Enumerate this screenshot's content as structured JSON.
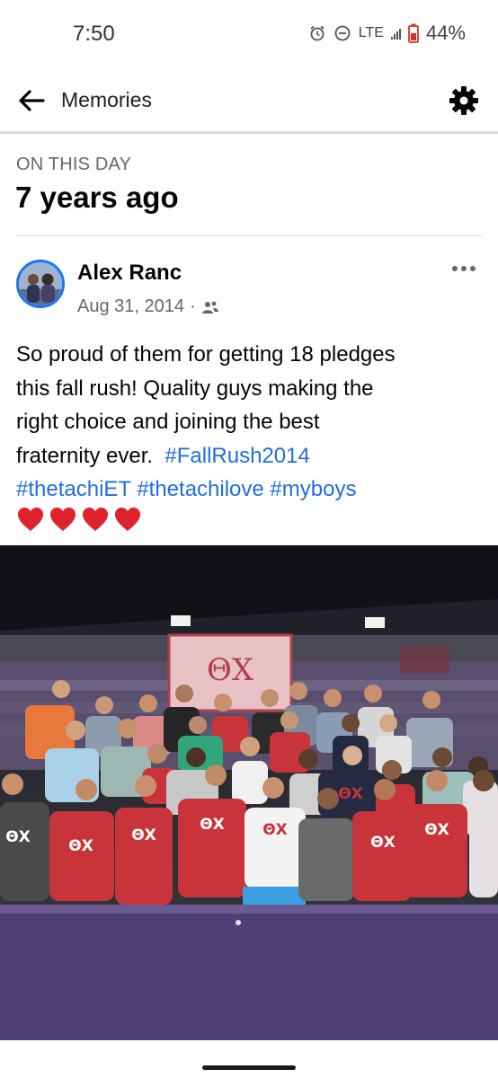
{
  "status_bar": {
    "time": "7:50",
    "network": "LTE",
    "battery": "44%",
    "icons": [
      "alarm-icon",
      "do-not-disturb-icon",
      "signal-icon",
      "battery-icon"
    ]
  },
  "header": {
    "title": "Memories",
    "back_icon": "back-arrow-icon",
    "settings_icon": "gear-icon"
  },
  "memory": {
    "label": "ON THIS DAY",
    "years_ago": "7 years ago"
  },
  "post": {
    "author": "Alex Ranc",
    "date": "Aug 31, 2014",
    "separator": "·",
    "audience_icon": "friends-icon",
    "more_icon": "more-options-icon",
    "text_line1": "So proud of them for getting 18 pledges",
    "text_line2": "this fall rush! Quality guys making the",
    "text_line3": "right choice and joining the best",
    "text_line4": "fraternity ever. ",
    "tag1": "#FallRush2014",
    "tag2": "#thetachiET",
    "tag3": "#thetachilove",
    "tag4": "#myboys",
    "hearts_count": 4,
    "photo_banner": "ΘX",
    "photo_shirt_letters": "ΘX"
  },
  "colors": {
    "accent": "#1877f2",
    "hashtag": "#216fdb",
    "heart": "#e0222d",
    "shirt_red": "#c8343a"
  }
}
